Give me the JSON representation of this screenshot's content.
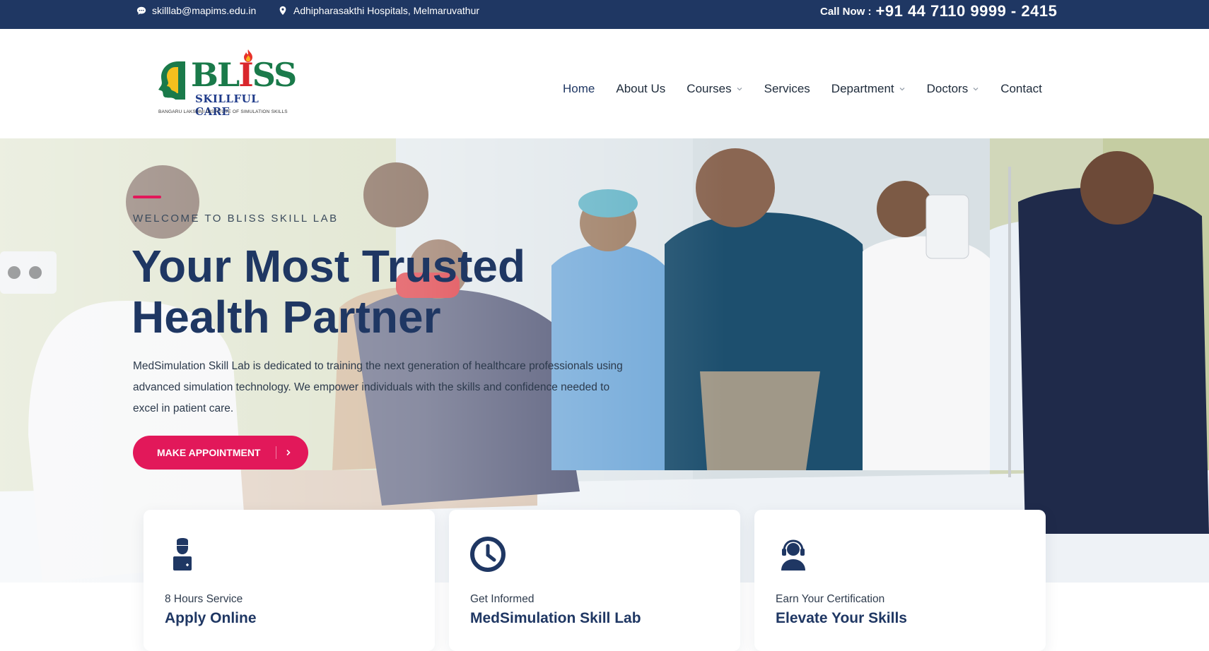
{
  "topbar": {
    "email": "skilllab@mapims.edu.in",
    "address": "Adhipharasakthi Hospitals, Melmaruvathur",
    "call_label": "Call Now :",
    "call_number": "+91 44 7110 9999 - 2415",
    "icons": {
      "email": "chat-bubble-icon",
      "address": "map-pin-icon"
    },
    "bg_color": "#1f3763"
  },
  "logo": {
    "word_prefix": "BL",
    "word_i": "I",
    "word_suffix": "SS",
    "sub": "SKILLFUL CARE",
    "tagline": "BANGARU LAKSHMI INSTITUTE OF SIMULATION SKILLS"
  },
  "nav": {
    "items": [
      {
        "label": "Home",
        "dropdown": false
      },
      {
        "label": "About Us",
        "dropdown": false
      },
      {
        "label": "Courses",
        "dropdown": true
      },
      {
        "label": "Services",
        "dropdown": false
      },
      {
        "label": "Department",
        "dropdown": true
      },
      {
        "label": "Doctors",
        "dropdown": true
      },
      {
        "label": "Contact",
        "dropdown": false
      }
    ]
  },
  "hero": {
    "eyebrow": "WELCOME TO BLISS SKILL LAB",
    "title_line1": "Your Most Trusted",
    "title_line2": "Health Partner",
    "text": "MedSimulation Skill Lab is dedicated to training the next generation of healthcare professionals using advanced simulation technology. We empower individuals with the skills and confidence needed to excel in patient care.",
    "button_label": "MAKE APPOINTMENT",
    "button_icon": "chevron-right-icon",
    "accent_color": "#e2185a",
    "title_color": "#1f3763"
  },
  "cards": [
    {
      "icon": "doctor-icon",
      "sub": "8 Hours Service",
      "title": "Apply Online"
    },
    {
      "icon": "clock-icon",
      "sub": "Get Informed",
      "title": "MedSimulation Skill Lab"
    },
    {
      "icon": "support-agent-icon",
      "sub": "Earn Your Certification",
      "title": "Elevate Your Skills"
    }
  ]
}
